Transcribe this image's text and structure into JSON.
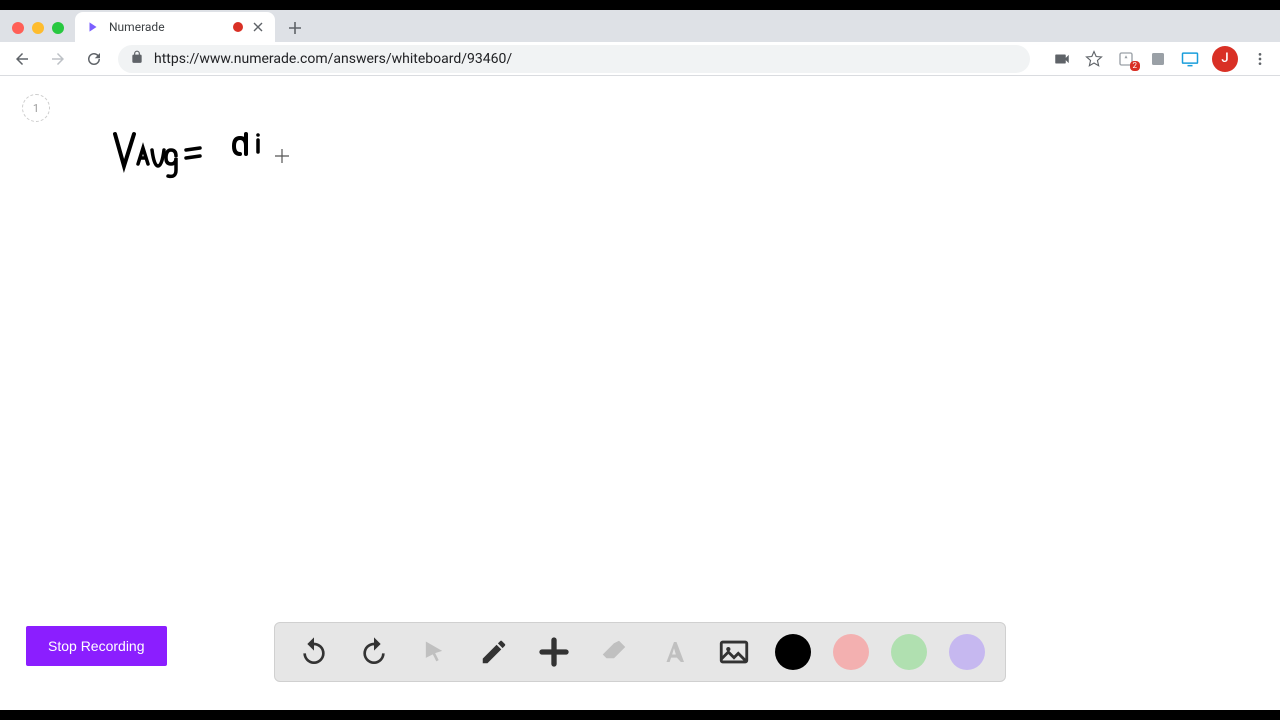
{
  "tab": {
    "title": "Numerade"
  },
  "url": "https://www.numerade.com/answers/whiteboard/93460/",
  "page_number": "1",
  "avatar_letter": "J",
  "extension_badge": "2",
  "stop_recording_label": "Stop Recording",
  "colors": {
    "black": "#000000",
    "pink": "#f3b0b0",
    "green": "#b0e0b0",
    "purple": "#c6b8f0",
    "accent": "#8b1eff"
  }
}
